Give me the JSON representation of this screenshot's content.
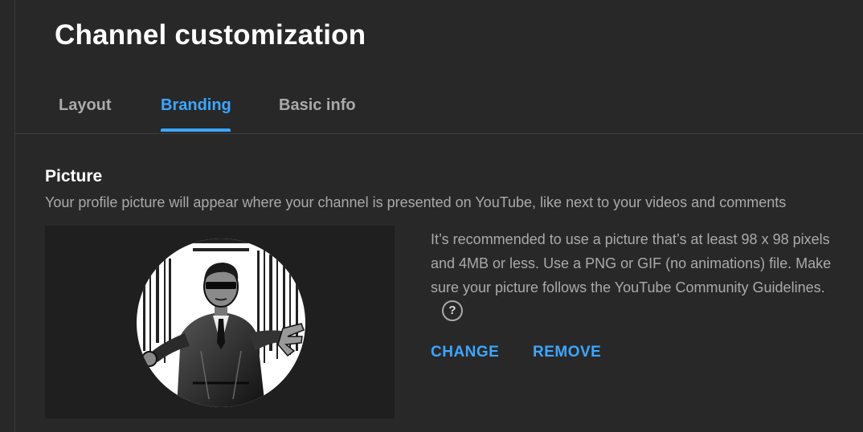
{
  "header": {
    "title": "Channel customization"
  },
  "tabs": [
    {
      "label": "Layout",
      "active": false
    },
    {
      "label": "Branding",
      "active": true
    },
    {
      "label": "Basic info",
      "active": false
    }
  ],
  "picture": {
    "title": "Picture",
    "description": "Your profile picture will appear where your channel is presented on YouTube, like next to your videos and comments",
    "recommendation": "It’s recommended to use a picture that’s at least 98 x 98 pixels and 4MB or less. Use a PNG or GIF (no animations) file. Make sure your picture follows the YouTube Community Guidelines.",
    "help_icon": "?",
    "change_label": "CHANGE",
    "remove_label": "REMOVE"
  },
  "colors": {
    "accent": "#3ea6ff",
    "background": "#282828",
    "secondary_text": "#aaaaaa"
  },
  "icons": {
    "help": "help-circle-icon"
  }
}
